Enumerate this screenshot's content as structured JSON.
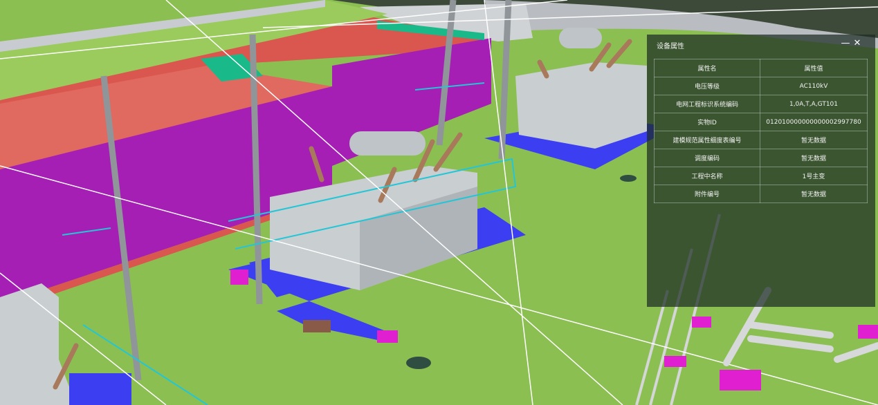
{
  "scene": {
    "description_icon": "3d-substation-view"
  },
  "panel": {
    "title": "设备属性",
    "minimize_icon": "—",
    "close_icon": "✕",
    "headers": [
      "属性名",
      "属性值"
    ],
    "rows": [
      [
        "电压等级",
        "AC110kV"
      ],
      [
        "电网工程标识系统编码",
        "1,0A,T,A,GT101"
      ],
      [
        "实物ID",
        "012010000000000002997780"
      ],
      [
        "建模规范属性细度表编号",
        "暂无数据"
      ],
      [
        "调度编码",
        "暂无数据"
      ],
      [
        "工程中名称",
        "1号主变"
      ],
      [
        "附件编号",
        "暂无数据"
      ]
    ]
  },
  "colors": {
    "ground": "#8cbf52",
    "wall_magenta": "#a51fb4",
    "roof_red": "#d9574f",
    "pad_blue": "#3c3ef2",
    "transformer_gray": "#c9ced1",
    "panel_bg": "#1c2c24"
  }
}
